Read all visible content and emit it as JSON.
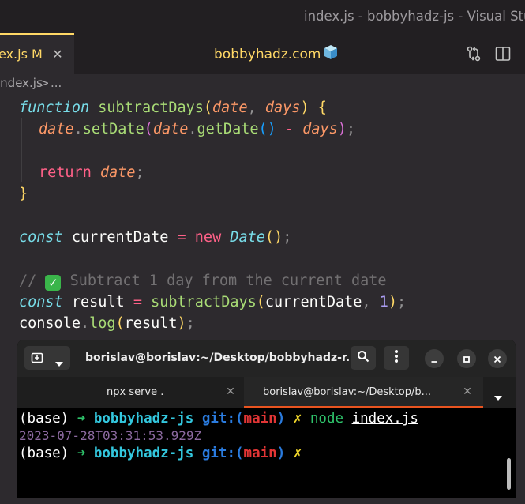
{
  "window": {
    "title": "index.js - bobbyhadz-js - Visual Studio Code"
  },
  "tab": {
    "file_name": "ex.js",
    "modified_flag": "M",
    "close_glyph": "✕"
  },
  "brand": {
    "text": "bobbyhadz.com",
    "icon": "cube-icon"
  },
  "breadcrumb": {
    "file": "index.js",
    "separator": ">",
    "more": "..."
  },
  "code": {
    "line1": {
      "kw": "function",
      "name": "subtractDays",
      "open": "(",
      "p1": "date",
      "comma": ",",
      "p2": "days",
      "close": ")",
      "brace": "{"
    },
    "line2": {
      "obj": "date",
      "dot": ".",
      "method": "setDate",
      "open": "(",
      "obj2": "date",
      "dot2": ".",
      "method2": "getDate",
      "inner": "()",
      "op": "-",
      "arg": "days",
      "close": ")",
      "semi": ";"
    },
    "line4": {
      "kw": "return",
      "val": "date",
      "semi": ";"
    },
    "line5": {
      "brace": "}"
    },
    "line7": {
      "kw": "const",
      "name": "currentDate",
      "eq": "=",
      "new_kw": "new",
      "cls": "Date",
      "call": "()",
      "semi": ";"
    },
    "line9": {
      "prefix": "//",
      "emoji": "✓",
      "text": "Subtract 1 day from the current date"
    },
    "line10": {
      "kw": "const",
      "name": "result",
      "eq": "=",
      "fn": "subtractDays",
      "open": "(",
      "arg": "currentDate",
      "comma": ",",
      "num": "1",
      "close": ")",
      "semi": ";"
    },
    "line11": {
      "obj": "console",
      "dot": ".",
      "method": "log",
      "open": "(",
      "arg": "result",
      "close": ")",
      "semi": ";"
    }
  },
  "terminal": {
    "title": "borislav@borislav:~/Desktop/bobbyhadz-r...",
    "tabs": [
      {
        "label": "npx serve .",
        "close": "✕"
      },
      {
        "label": "borislav@borislav:~/Desktop/b...",
        "close": "✕"
      }
    ],
    "lines": [
      {
        "env": "(base)",
        "arrow": "➜",
        "dir": "bobbyhadz-js",
        "git": "git:(",
        "branch": "main",
        "git_close": ")",
        "dirty": "✗",
        "cmd": "node",
        "arg": "index.js"
      },
      {
        "output": "2023-07-28T03:31:53.929Z"
      },
      {
        "env": "(base)",
        "arrow": "➜",
        "dir": "bobbyhadz-js",
        "git": "git:(",
        "branch": "main",
        "git_close": ")",
        "dirty": "✗"
      }
    ]
  },
  "colors": {
    "editor_bg": "#2d2a2e",
    "accent_yellow": "#ffd866",
    "keyword_pink": "#ff6188",
    "function_green": "#a9dc76",
    "param_orange": "#fc9867",
    "terminal_tab_underline": "#e95420"
  }
}
